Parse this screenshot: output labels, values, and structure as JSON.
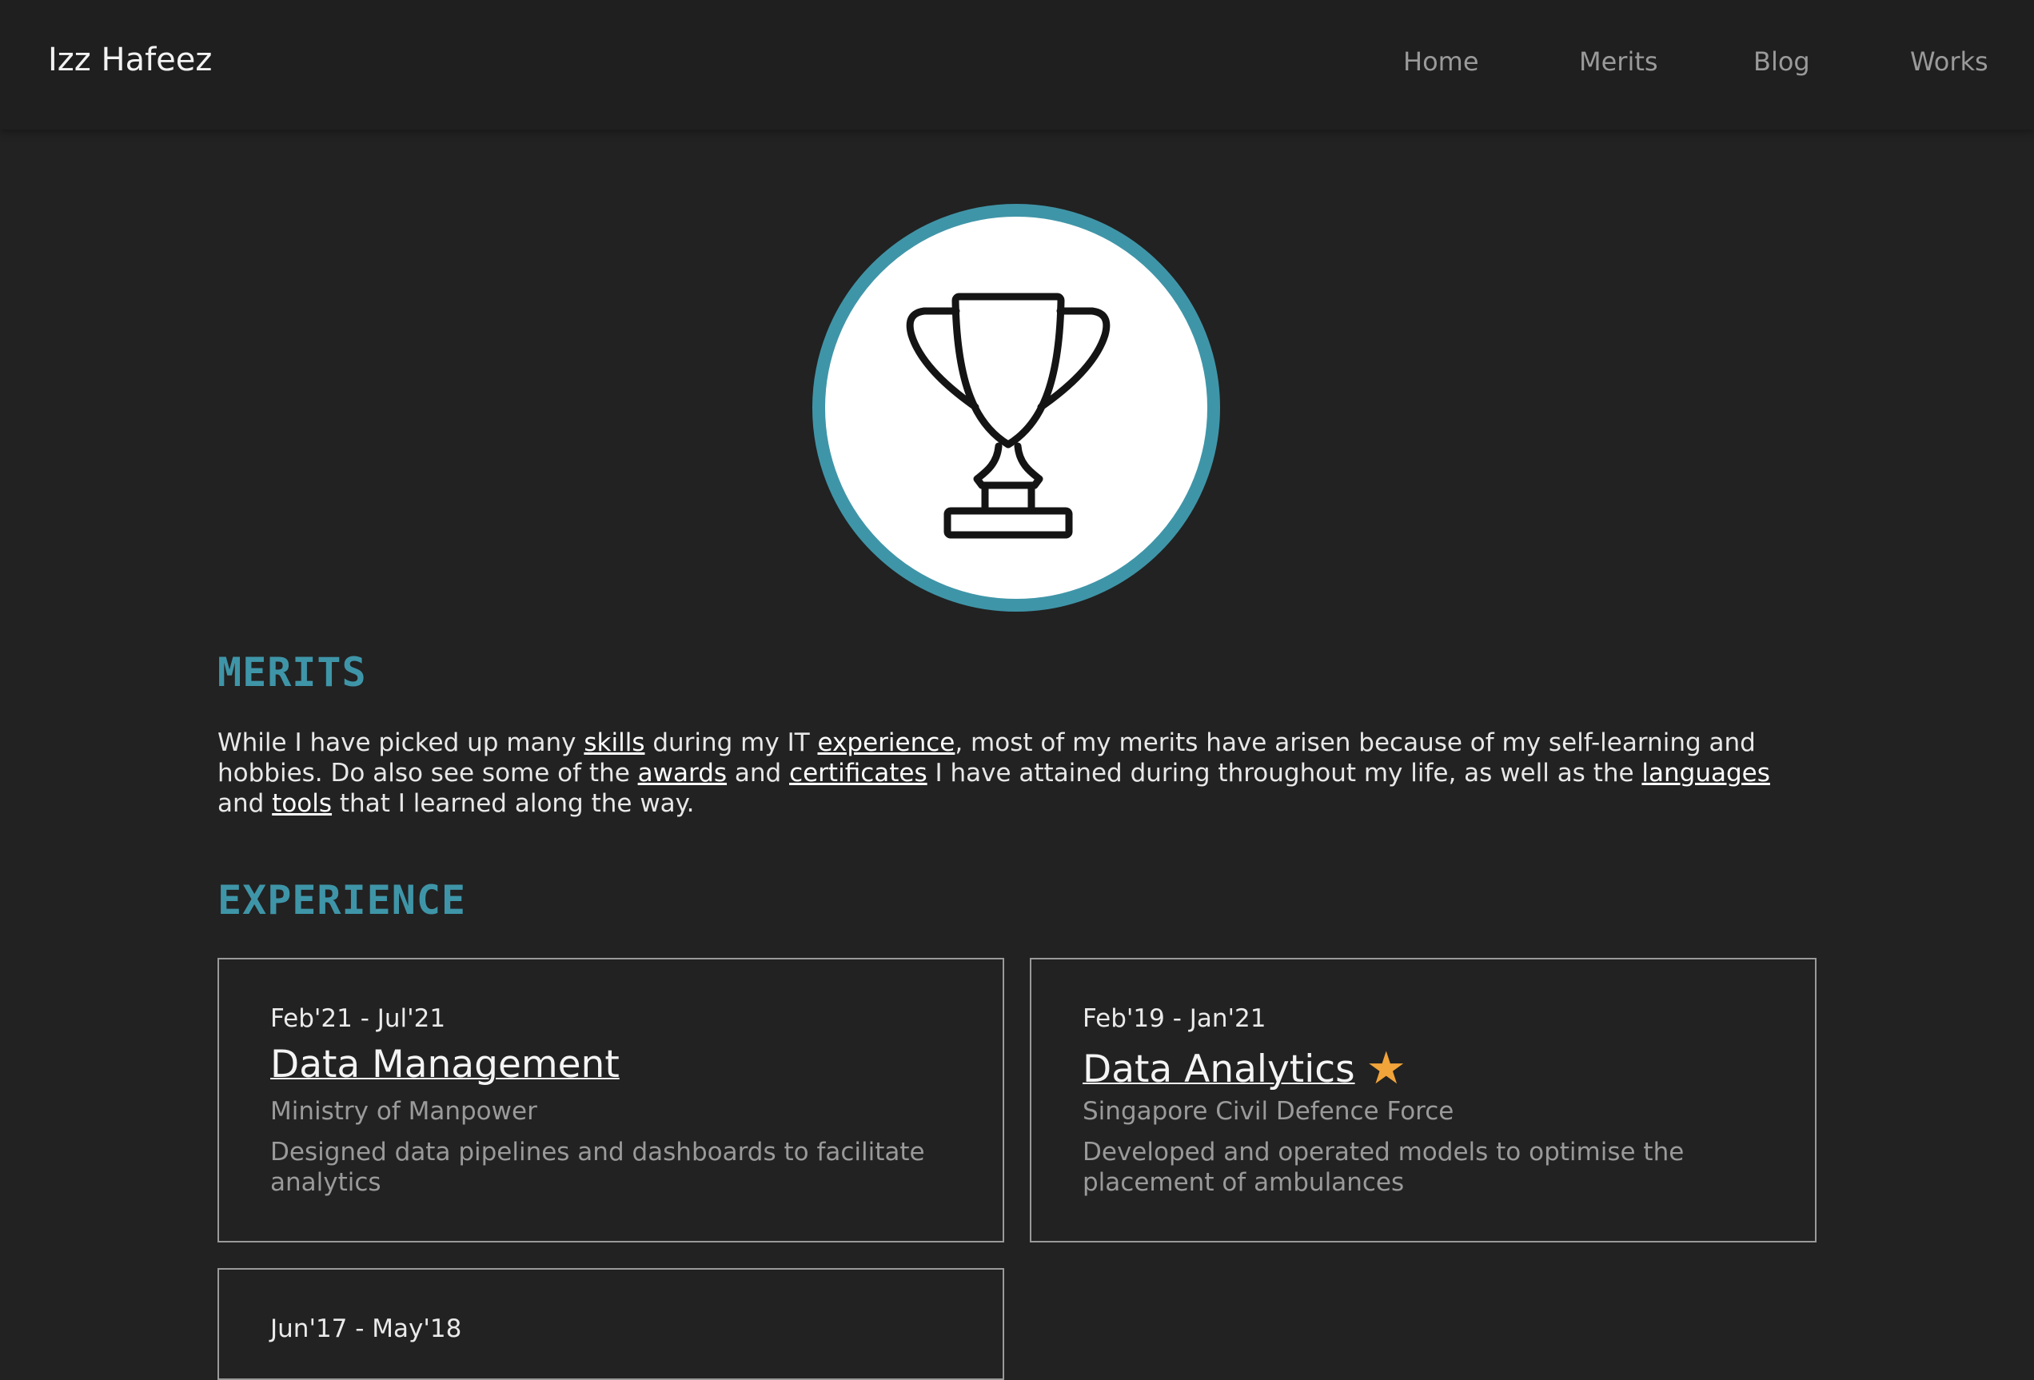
{
  "nav": {
    "brand": "Izz Hafeez",
    "links": [
      "Home",
      "Merits",
      "Blog",
      "Works"
    ]
  },
  "hero": {
    "icon": "trophy-icon",
    "ring_color": "#3f95a8"
  },
  "merits": {
    "heading": "MERITS",
    "intro": [
      "While I have picked up many ",
      "skills",
      " during my IT ",
      "experience",
      ", most of my merits have arisen because of my self-learning and hobbies. Do also see some of the ",
      "awards",
      " and ",
      "certificates",
      " I have attained during throughout my life, as well as the ",
      "languages",
      " and ",
      "tools",
      " that I learned along the way."
    ]
  },
  "experience": {
    "heading": "EXPERIENCE",
    "items": [
      {
        "dates": "Feb'21 - Jul'21",
        "title": "Data Management",
        "org": "Ministry of Manpower",
        "description": "Designed data pipelines and dashboards to facilitate analytics",
        "starred": false
      },
      {
        "dates": "Feb'19 - Jan'21",
        "title": "Data Analytics",
        "org": "Singapore Civil Defence Force",
        "description": "Developed and operated models to optimise the placement of ambulances",
        "starred": true,
        "star_icon": "★",
        "star_color": "#f1a43a"
      },
      {
        "dates": "Jun'17 - May'18"
      }
    ]
  },
  "colors": {
    "background": "#222222",
    "navbar": "#1f1f1f",
    "accent": "#3f95a8",
    "muted_text": "#9a9a9a",
    "card_border": "#9a9a9a"
  }
}
